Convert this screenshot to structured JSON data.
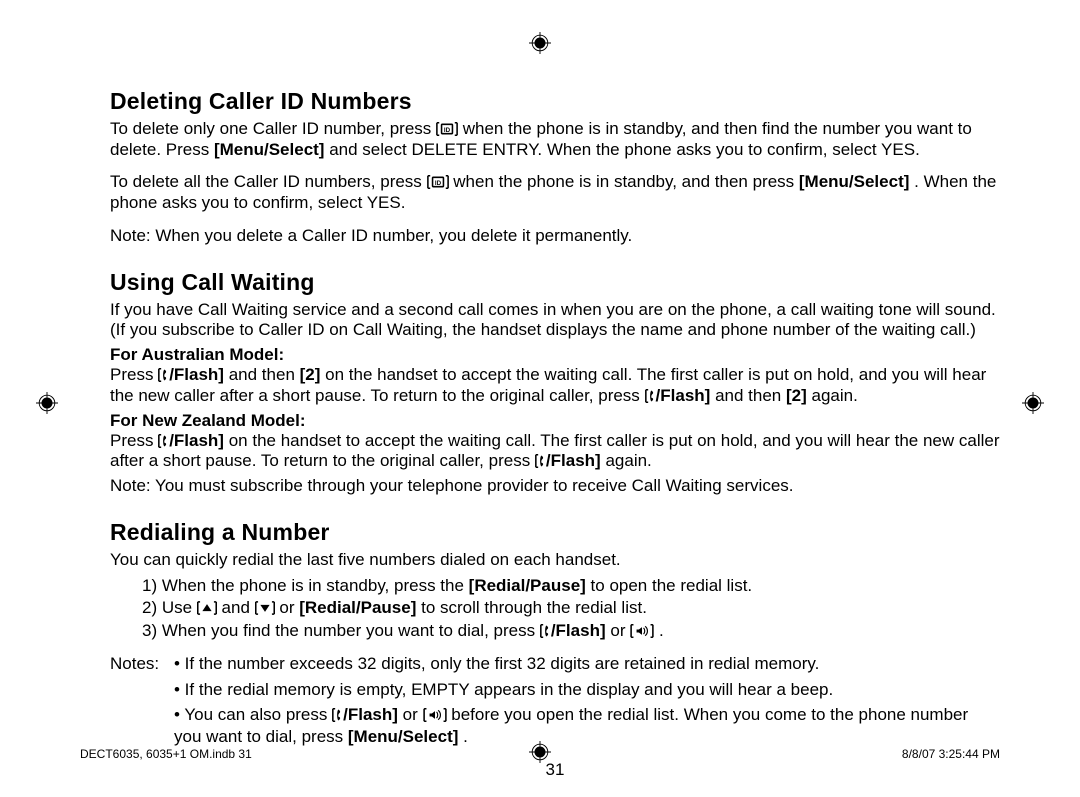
{
  "sections": {
    "deleting": {
      "heading": "Deleting Caller ID Numbers",
      "p1_a": "To delete only one Caller ID number, press ",
      "p1_b": " when the phone is in standby, and then find the number you want to delete. Press ",
      "p1_menu": "[Menu/Select]",
      "p1_c": " and select DELETE ENTRY. When the phone asks you to confirm, select YES.",
      "p2_a": "To delete all the Caller ID numbers, press ",
      "p2_b": " when the phone is in standby, and then press ",
      "p2_menu": "[Menu/Select]",
      "p2_c": ". When the phone asks you to confirm, select YES.",
      "note": "Note: When you delete a Caller ID number, you delete it permanently."
    },
    "callwaiting": {
      "heading": "Using Call Waiting",
      "intro": "If you have Call Waiting service and a second call comes in when you are on the phone, a call waiting tone will sound. (If you subscribe to Caller ID on Call Waiting, the handset displays the name and phone number of the waiting call.)",
      "aus_head": "For Australian Model:",
      "aus_a": "Press ",
      "flash_key": "/Flash]",
      "aus_b": " and then ",
      "two_key": "[2]",
      "aus_c": " on the handset to accept the waiting call. The first caller is put on hold, and you will hear the new caller after a short pause. To return to the original caller, press ",
      "aus_d": " and then ",
      "aus_e": " again.",
      "nz_head": "For New Zealand Model:",
      "nz_a": "Press ",
      "nz_b": " on the handset to accept the waiting call. The first caller is put on hold, and you will hear the new caller after a short pause. To return to the original caller, press ",
      "nz_c": " again.",
      "cw_note": "Note: You must subscribe through your telephone provider to receive Call Waiting services."
    },
    "redial": {
      "heading": "Redialing a Number",
      "intro": "You can quickly redial the last five numbers dialed on each handset.",
      "step1_a": "1) When the phone is in standby, press the ",
      "redial_key": "[Redial/Pause]",
      "step1_b": " to open the redial list.",
      "step2_a": "2) Use ",
      "step2_b": " and ",
      "step2_c": " or ",
      "step2_d": " to scroll through the redial list.",
      "step3_a": "3) When you find the number you want to dial, press ",
      "step3_b": " or ",
      "step3_c": ".",
      "notes_label": "Notes: ",
      "n1": "• If the number exceeds 32 digits, only the first 32 digits are retained in redial memory.",
      "n2": "• If the redial memory is empty, EMPTY appears in the display and you will hear a beep.",
      "n3_a": "• You can also press ",
      "n3_b": " or ",
      "n3_c": " before you open the redial list. When you come to the phone number you want to dial, press ",
      "menu_select": "[Menu/Select]",
      "n3_d": "."
    }
  },
  "page_number": "31",
  "footer_left": "DECT6035, 6035+1 OM.indb   31",
  "footer_right": "8/8/07   3:25:44 PM",
  "icons": {
    "cid": "caller-id-icon",
    "phone_bracket": "phone-flash-icon",
    "up": "up-arrow-key",
    "down": "down-arrow-key",
    "speaker": "speaker-key"
  }
}
